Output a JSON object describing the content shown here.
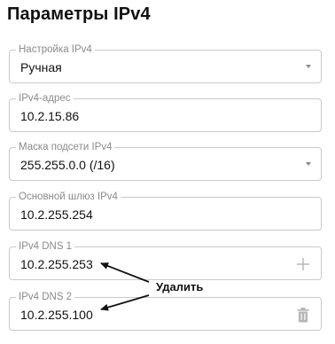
{
  "page": {
    "title": "Параметры IPv4"
  },
  "fields": {
    "ipv4_config": {
      "label": "Настройка IPv4",
      "value": "Ручная"
    },
    "ipv4_address": {
      "label": "IPv4-адрес",
      "value": "10.2.15.86"
    },
    "subnet_mask": {
      "label": "Маска подсети IPv4",
      "value": "255.255.0.0 (/16)"
    },
    "gateway": {
      "label": "Основной шлюз IPv4",
      "value": "10.2.255.254"
    },
    "dns1": {
      "label": "IPv4 DNS 1",
      "value": "10.2.255.253",
      "action_icon": "plus-icon"
    },
    "dns2": {
      "label": "IPv4 DNS 2",
      "value": "10.2.255.100",
      "action_icon": "trash-icon"
    }
  },
  "annotation": {
    "label": "Удалить"
  },
  "colors": {
    "border": "#c9c9c9",
    "label": "#8a8a8a",
    "icon": "#b5b5b5",
    "text": "#111111"
  }
}
